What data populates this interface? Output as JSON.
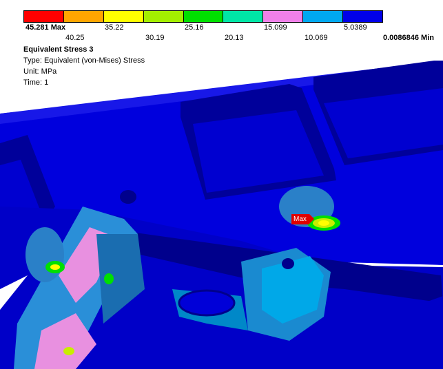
{
  "result": {
    "title": "Equivalent Stress 3",
    "type": "Type: Equivalent (von-Mises) Stress",
    "unit": "Unit: MPa",
    "time": "Time: 1"
  },
  "legend": {
    "colors": [
      "#ff0000",
      "#ffa500",
      "#ffff00",
      "#a3ee00",
      "#00e000",
      "#00e6a6",
      "#f080e8",
      "#00a8f0",
      "#0000e8"
    ],
    "max_label": "45.281 Max",
    "min_label": "0.0086846 Min",
    "top_row": [
      "35.22",
      "25.16",
      "15.099",
      "5.0389"
    ],
    "bottom_row": [
      "40.25",
      "30.19",
      "20.13",
      "10.069"
    ]
  },
  "probe": {
    "max_tag": "Max"
  },
  "colors": {
    "background": "#ffffff",
    "model_blue": "#0000e0",
    "model_dark": "#00008c"
  }
}
